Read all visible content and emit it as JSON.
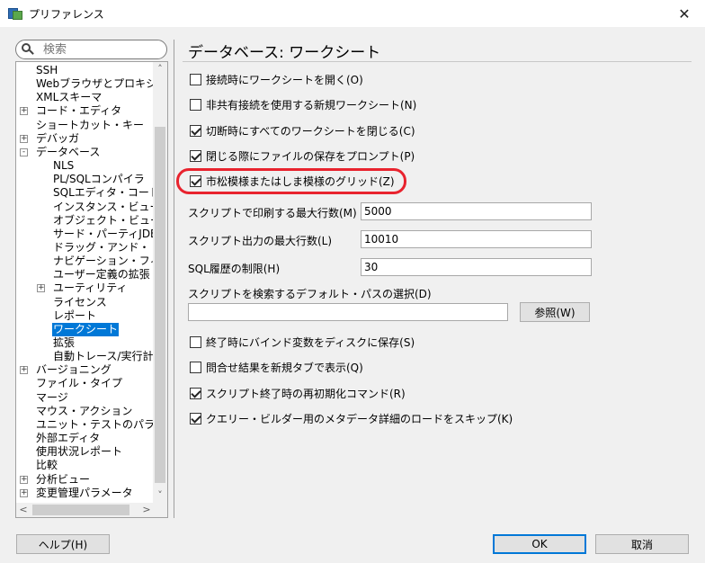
{
  "window": {
    "title": "プリファレンス",
    "close_glyph": "✕"
  },
  "search": {
    "placeholder": "検索"
  },
  "tree": {
    "items": [
      {
        "label": "SSH",
        "indent": 1,
        "expander": ""
      },
      {
        "label": "Webブラウザとプロキシ",
        "indent": 1,
        "expander": ""
      },
      {
        "label": "XMLスキーマ",
        "indent": 1,
        "expander": ""
      },
      {
        "label": "コード・エディタ",
        "indent": 1,
        "expander": "+"
      },
      {
        "label": "ショートカット・キー",
        "indent": 1,
        "expander": ""
      },
      {
        "label": "デバッガ",
        "indent": 1,
        "expander": "+"
      },
      {
        "label": "データベース",
        "indent": 1,
        "expander": "-"
      },
      {
        "label": "NLS",
        "indent": 2,
        "expander": ""
      },
      {
        "label": "PL/SQLコンパイラ",
        "indent": 2,
        "expander": ""
      },
      {
        "label": "SQLエディタ・コード・",
        "indent": 2,
        "expander": ""
      },
      {
        "label": "インスタンス・ビューア",
        "indent": 2,
        "expander": ""
      },
      {
        "label": "オブジェクト・ビューア",
        "indent": 2,
        "expander": ""
      },
      {
        "label": "サード・パーティJDBC",
        "indent": 2,
        "expander": ""
      },
      {
        "label": "ドラッグ・アンド・ドロップ",
        "indent": 2,
        "expander": ""
      },
      {
        "label": "ナビゲーション・フィル",
        "indent": 2,
        "expander": ""
      },
      {
        "label": "ユーザー定義の拡張",
        "indent": 2,
        "expander": ""
      },
      {
        "label": "ユーティリティ",
        "indent": 2,
        "expander": "+"
      },
      {
        "label": "ライセンス",
        "indent": 2,
        "expander": ""
      },
      {
        "label": "レポート",
        "indent": 2,
        "expander": ""
      },
      {
        "label": "ワークシート",
        "indent": 2,
        "expander": "",
        "selected": true
      },
      {
        "label": "拡張",
        "indent": 2,
        "expander": ""
      },
      {
        "label": "自動トレース/実行計",
        "indent": 2,
        "expander": ""
      },
      {
        "label": "バージョニング",
        "indent": 1,
        "expander": "+"
      },
      {
        "label": "ファイル・タイプ",
        "indent": 1,
        "expander": ""
      },
      {
        "label": "マージ",
        "indent": 1,
        "expander": ""
      },
      {
        "label": "マウス・アクション",
        "indent": 1,
        "expander": ""
      },
      {
        "label": "ユニット・テストのパラメー",
        "indent": 1,
        "expander": ""
      },
      {
        "label": "外部エディタ",
        "indent": 1,
        "expander": ""
      },
      {
        "label": "使用状況レポート",
        "indent": 1,
        "expander": ""
      },
      {
        "label": "比較",
        "indent": 1,
        "expander": ""
      },
      {
        "label": "分析ビュー",
        "indent": 1,
        "expander": "+"
      },
      {
        "label": "変更管理パラメータ",
        "indent": 1,
        "expander": "+"
      }
    ],
    "scroll_up": "˄",
    "scroll_down": "˅",
    "scroll_left": "<",
    "scroll_right": ">"
  },
  "page": {
    "title": "データベース: ワークシート",
    "options_top": [
      {
        "label": "接続時にワークシートを開く(O)",
        "checked": false
      },
      {
        "label": "非共有接続を使用する新規ワークシート(N)",
        "checked": false
      },
      {
        "label": "切断時にすべてのワークシートを閉じる(C)",
        "checked": true
      },
      {
        "label": "閉じる際にファイルの保存をプロンプト(P)",
        "checked": true
      },
      {
        "label": "市松模様またはしま模様のグリッド(Z)",
        "checked": true
      }
    ],
    "max_print_rows": {
      "label": "スクリプトで印刷する最大行数(M)",
      "value": "5000"
    },
    "max_output_rows": {
      "label": "スクリプト出力の最大行数(L)",
      "value": "10010"
    },
    "sql_history_limit": {
      "label": "SQL履歴の制限(H)",
      "value": "30"
    },
    "default_path": {
      "label": "スクリプトを検索するデフォルト・パスの選択(D)",
      "value": "",
      "browse": "参照(W)"
    },
    "options_bottom": [
      {
        "label": "終了時にバインド変数をディスクに保存(S)",
        "checked": false
      },
      {
        "label": "問合せ結果を新規タブで表示(Q)",
        "checked": false
      },
      {
        "label": "スクリプト終了時の再初期化コマンド(R)",
        "checked": true
      },
      {
        "label": "クエリー・ビルダー用のメタデータ詳細のロードをスキップ(K)",
        "checked": true
      }
    ]
  },
  "footer": {
    "help": "ヘルプ(H)",
    "ok": "OK",
    "cancel": "取消"
  },
  "colors": {
    "highlight": "#e8232e",
    "selection": "#0078d7"
  }
}
